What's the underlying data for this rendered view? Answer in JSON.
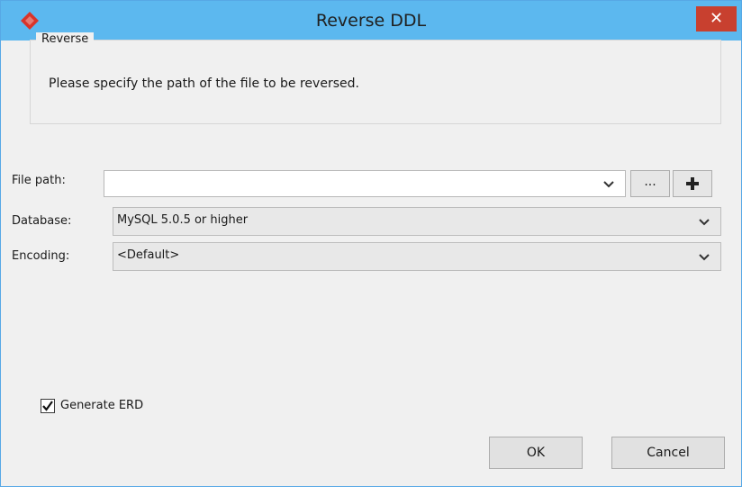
{
  "window": {
    "title": "Reverse DDL"
  },
  "icons": {
    "app": "app-logo-icon",
    "close": "close-icon",
    "chevron": "chevron-down-icon",
    "plus": "plus-icon",
    "check": "checkmark-icon"
  },
  "colors": {
    "titlebar": "#5cb8ef",
    "close": "#c8402f"
  },
  "group": {
    "title": "Reverse",
    "message": "Please specify the path of the file to be reversed."
  },
  "form": {
    "file_path_label": "File path:",
    "file_path_value": "",
    "browse_label": "...",
    "database_label": "Database:",
    "database_value": "MySQL 5.0.5 or higher",
    "encoding_label": "Encoding:",
    "encoding_value": "<Default>"
  },
  "options": {
    "generate_erd_label": "Generate ERD",
    "generate_erd_checked": true
  },
  "buttons": {
    "ok": "OK",
    "cancel": "Cancel"
  }
}
